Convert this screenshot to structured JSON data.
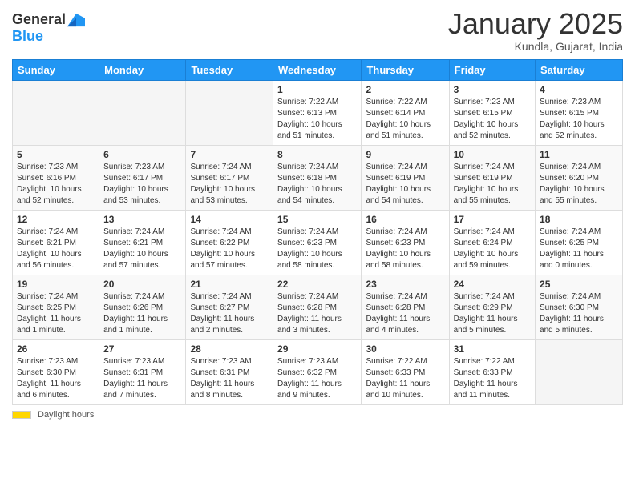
{
  "header": {
    "logo_general": "General",
    "logo_blue": "Blue",
    "month": "January 2025",
    "location": "Kundla, Gujarat, India"
  },
  "days_of_week": [
    "Sunday",
    "Monday",
    "Tuesday",
    "Wednesday",
    "Thursday",
    "Friday",
    "Saturday"
  ],
  "weeks": [
    [
      {
        "num": "",
        "info": ""
      },
      {
        "num": "",
        "info": ""
      },
      {
        "num": "",
        "info": ""
      },
      {
        "num": "1",
        "info": "Sunrise: 7:22 AM\nSunset: 6:13 PM\nDaylight: 10 hours\nand 51 minutes."
      },
      {
        "num": "2",
        "info": "Sunrise: 7:22 AM\nSunset: 6:14 PM\nDaylight: 10 hours\nand 51 minutes."
      },
      {
        "num": "3",
        "info": "Sunrise: 7:23 AM\nSunset: 6:15 PM\nDaylight: 10 hours\nand 52 minutes."
      },
      {
        "num": "4",
        "info": "Sunrise: 7:23 AM\nSunset: 6:15 PM\nDaylight: 10 hours\nand 52 minutes."
      }
    ],
    [
      {
        "num": "5",
        "info": "Sunrise: 7:23 AM\nSunset: 6:16 PM\nDaylight: 10 hours\nand 52 minutes."
      },
      {
        "num": "6",
        "info": "Sunrise: 7:23 AM\nSunset: 6:17 PM\nDaylight: 10 hours\nand 53 minutes."
      },
      {
        "num": "7",
        "info": "Sunrise: 7:24 AM\nSunset: 6:17 PM\nDaylight: 10 hours\nand 53 minutes."
      },
      {
        "num": "8",
        "info": "Sunrise: 7:24 AM\nSunset: 6:18 PM\nDaylight: 10 hours\nand 54 minutes."
      },
      {
        "num": "9",
        "info": "Sunrise: 7:24 AM\nSunset: 6:19 PM\nDaylight: 10 hours\nand 54 minutes."
      },
      {
        "num": "10",
        "info": "Sunrise: 7:24 AM\nSunset: 6:19 PM\nDaylight: 10 hours\nand 55 minutes."
      },
      {
        "num": "11",
        "info": "Sunrise: 7:24 AM\nSunset: 6:20 PM\nDaylight: 10 hours\nand 55 minutes."
      }
    ],
    [
      {
        "num": "12",
        "info": "Sunrise: 7:24 AM\nSunset: 6:21 PM\nDaylight: 10 hours\nand 56 minutes."
      },
      {
        "num": "13",
        "info": "Sunrise: 7:24 AM\nSunset: 6:21 PM\nDaylight: 10 hours\nand 57 minutes."
      },
      {
        "num": "14",
        "info": "Sunrise: 7:24 AM\nSunset: 6:22 PM\nDaylight: 10 hours\nand 57 minutes."
      },
      {
        "num": "15",
        "info": "Sunrise: 7:24 AM\nSunset: 6:23 PM\nDaylight: 10 hours\nand 58 minutes."
      },
      {
        "num": "16",
        "info": "Sunrise: 7:24 AM\nSunset: 6:23 PM\nDaylight: 10 hours\nand 58 minutes."
      },
      {
        "num": "17",
        "info": "Sunrise: 7:24 AM\nSunset: 6:24 PM\nDaylight: 10 hours\nand 59 minutes."
      },
      {
        "num": "18",
        "info": "Sunrise: 7:24 AM\nSunset: 6:25 PM\nDaylight: 11 hours\nand 0 minutes."
      }
    ],
    [
      {
        "num": "19",
        "info": "Sunrise: 7:24 AM\nSunset: 6:25 PM\nDaylight: 11 hours\nand 1 minute."
      },
      {
        "num": "20",
        "info": "Sunrise: 7:24 AM\nSunset: 6:26 PM\nDaylight: 11 hours\nand 1 minute."
      },
      {
        "num": "21",
        "info": "Sunrise: 7:24 AM\nSunset: 6:27 PM\nDaylight: 11 hours\nand 2 minutes."
      },
      {
        "num": "22",
        "info": "Sunrise: 7:24 AM\nSunset: 6:28 PM\nDaylight: 11 hours\nand 3 minutes."
      },
      {
        "num": "23",
        "info": "Sunrise: 7:24 AM\nSunset: 6:28 PM\nDaylight: 11 hours\nand 4 minutes."
      },
      {
        "num": "24",
        "info": "Sunrise: 7:24 AM\nSunset: 6:29 PM\nDaylight: 11 hours\nand 5 minutes."
      },
      {
        "num": "25",
        "info": "Sunrise: 7:24 AM\nSunset: 6:30 PM\nDaylight: 11 hours\nand 5 minutes."
      }
    ],
    [
      {
        "num": "26",
        "info": "Sunrise: 7:23 AM\nSunset: 6:30 PM\nDaylight: 11 hours\nand 6 minutes."
      },
      {
        "num": "27",
        "info": "Sunrise: 7:23 AM\nSunset: 6:31 PM\nDaylight: 11 hours\nand 7 minutes."
      },
      {
        "num": "28",
        "info": "Sunrise: 7:23 AM\nSunset: 6:31 PM\nDaylight: 11 hours\nand 8 minutes."
      },
      {
        "num": "29",
        "info": "Sunrise: 7:23 AM\nSunset: 6:32 PM\nDaylight: 11 hours\nand 9 minutes."
      },
      {
        "num": "30",
        "info": "Sunrise: 7:22 AM\nSunset: 6:33 PM\nDaylight: 11 hours\nand 10 minutes."
      },
      {
        "num": "31",
        "info": "Sunrise: 7:22 AM\nSunset: 6:33 PM\nDaylight: 11 hours\nand 11 minutes."
      },
      {
        "num": "",
        "info": ""
      }
    ]
  ],
  "footer": {
    "daylight_label": "Daylight hours"
  }
}
